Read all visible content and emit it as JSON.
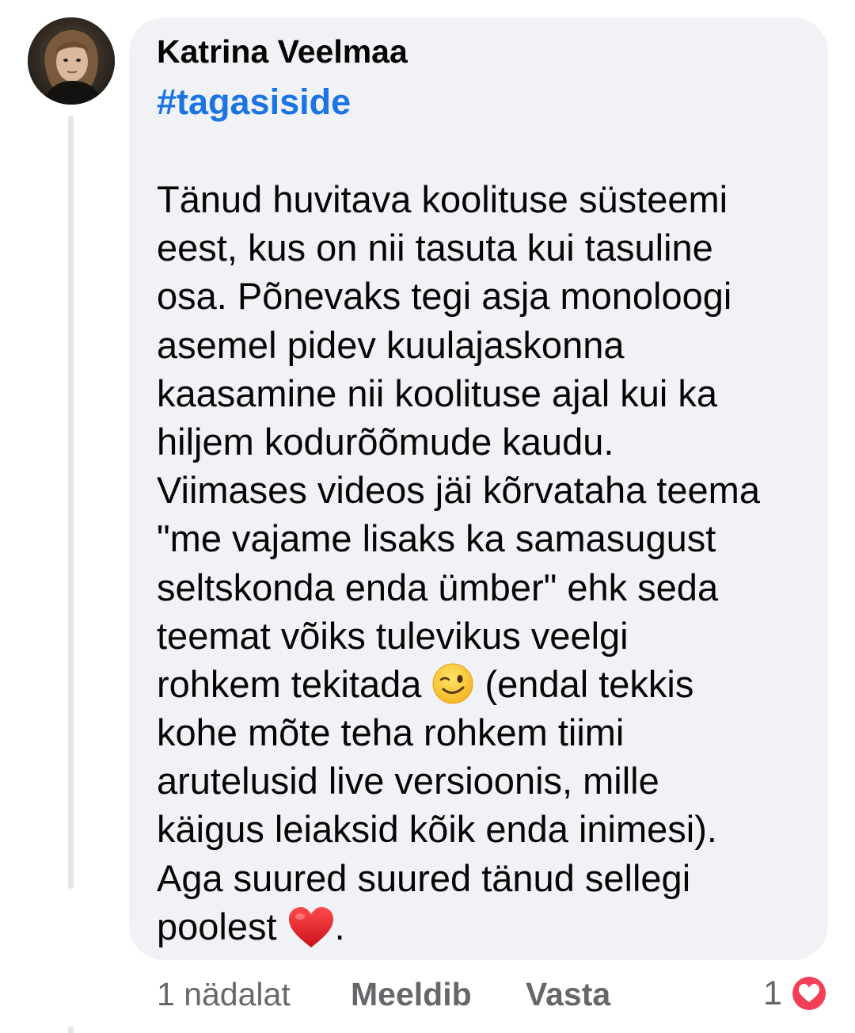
{
  "comment": {
    "author": "Katrina Veelmaa",
    "hashtag": "#tagasiside",
    "lines": [
      "Tänud huvitava koolituse süsteemi",
      "eest, kus on nii tasuta kui tasuline",
      "osa. Põnevaks tegi asja monoloogi",
      "asemel pidev kuulajaskonna",
      "kaasamine nii koolituse ajal kui ka",
      "hiljem kodurõõmude kaudu.",
      "Viimases videos jäi kõrvataha teema",
      "\"me vajame lisaks ka samasugust",
      "seltskonda enda ümber\" ehk seda",
      "teemat võiks tulevikus veelgi"
    ],
    "line_emoji_before": "rohkem tekitada ",
    "line_emoji_after": " (endal tekkis",
    "emoji_wink": "winking-face-emoji",
    "lines_after": [
      "kohe mõte teha rohkem tiimi",
      "arutelusid live versioonis, mille",
      "käigus leiaksid kõik enda inimesi).",
      "Aga suured suured tänud sellegi"
    ],
    "last_line_before": "poolest ",
    "last_line_after": ".",
    "emoji_heart": "red-heart-emoji"
  },
  "actions": {
    "time": "1 nädalat",
    "like_label": "Meeldib",
    "reply_label": "Vasta",
    "reaction_count": "1",
    "reaction_icon": "love-reaction-icon"
  },
  "colors": {
    "bubble": "#f0f2f5",
    "hashtag": "#1b74e4",
    "meta_text": "#65676b",
    "love_reaction": "#f33e58"
  }
}
